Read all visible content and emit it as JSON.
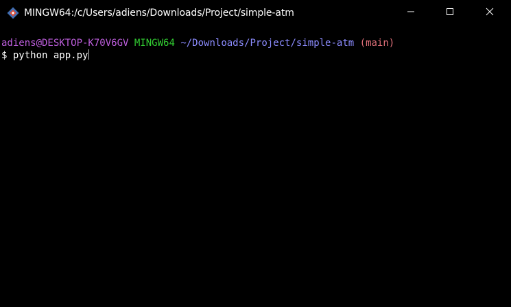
{
  "window": {
    "title": "MINGW64:/c/Users/adiens/Downloads/Project/simple-atm",
    "app_icon": "git-bash-icon",
    "controls": {
      "minimize_icon": "minimize-icon",
      "maximize_icon": "maximize-icon",
      "close_icon": "close-icon"
    }
  },
  "terminal": {
    "prompt": {
      "user_host": "adiens@DESKTOP-K70V6GV",
      "env": "MINGW64",
      "path": "~/Downloads/Project/simple-atm",
      "branch": "(main)"
    },
    "command_line": {
      "symbol": "$",
      "command": "python app.py"
    }
  },
  "colors": {
    "background": "#000000",
    "user_host": "#bf5fdf",
    "env": "#32cd32",
    "path": "#8c8cff",
    "branch": "#e0707a",
    "text": "#ffffff"
  }
}
